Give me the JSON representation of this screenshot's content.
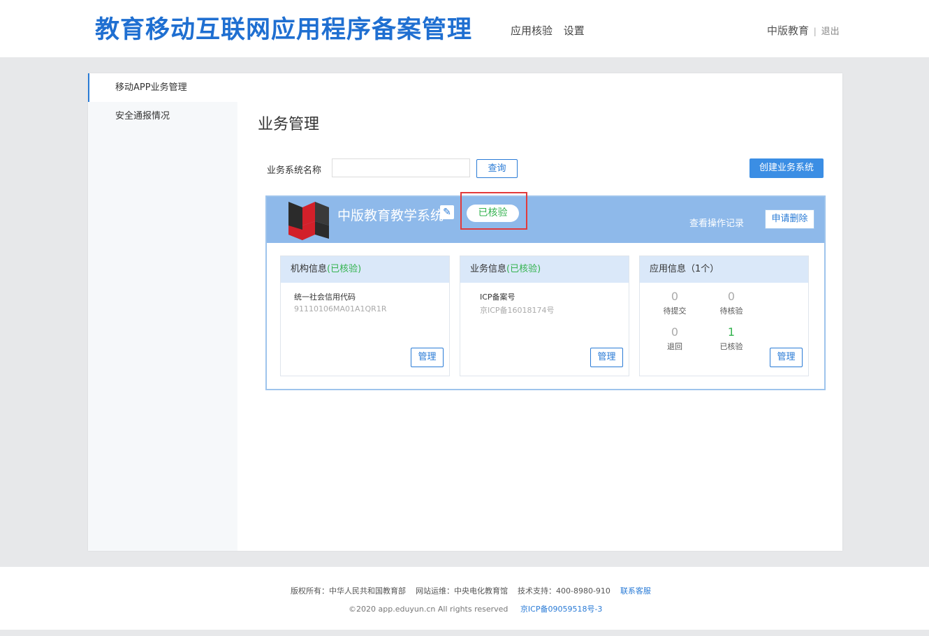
{
  "header": {
    "site_title": "教育移动互联网应用程序备案管理",
    "nav": [
      "应用核验",
      "设置"
    ],
    "user": "中版教育",
    "separator": "|",
    "logout": "退出"
  },
  "sidebar": {
    "items": [
      {
        "label": "移动APP业务管理",
        "active": true
      },
      {
        "label": "安全通报情况",
        "active": false
      }
    ]
  },
  "main": {
    "title": "业务管理",
    "search": {
      "label": "业务系统名称",
      "value": "",
      "placeholder": ""
    },
    "query_button": "查询",
    "create_button": "创建业务系统"
  },
  "system_card": {
    "name": "中版教育教学系统",
    "status": "已核验",
    "view_log": "查看操作记录",
    "delete_button": "申请删除",
    "org_info": {
      "title": "机构信息",
      "status": "(已核验)",
      "field_label": "统一社会信用代码",
      "field_value": "91110106MA01A1QR1R",
      "manage": "管理"
    },
    "biz_info": {
      "title": "业务信息",
      "status": "(已核验)",
      "field_label": "ICP备案号",
      "field_value": "京ICP备16018174号",
      "manage": "管理"
    },
    "app_info": {
      "title": "应用信息（1个）",
      "stats": [
        {
          "value": "0",
          "label": "待提交"
        },
        {
          "value": "0",
          "label": "待核验"
        },
        {
          "value": "0",
          "label": "退回"
        },
        {
          "value": "1",
          "label": "已核验"
        }
      ],
      "manage": "管理"
    }
  },
  "footer": {
    "copyright": "版权所有：中华人民共和国教育部",
    "operator": "网站运维：中央电化教育馆",
    "support": "技术支持：400-8980-910",
    "contact": "联系客服",
    "rights": "©2020 app.eduyun.cn All rights reserved",
    "icp": "京ICP备09059518号-3"
  },
  "colors": {
    "brand": "#1f6fd1",
    "accent": "#3b8ee4",
    "verified": "#34b34f",
    "highlight": "#e23a3a"
  }
}
